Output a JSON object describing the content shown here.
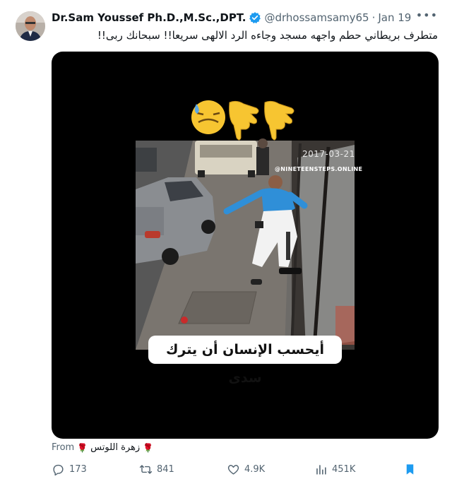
{
  "author": {
    "display_name": "Dr.Sam Youssef Ph.D.,M.Sc.,DPT.",
    "handle": "@drhossamsamy65",
    "separator": "·",
    "date": "Jan 19",
    "verified_icon": "verified-badge-icon",
    "verified_color": "#1d9bf0"
  },
  "tweet": {
    "text": "متطرف بريطاني حطم واجهه مسجد وجاءه الرد الالهى سريعا!! سبحانك ربى!!"
  },
  "media": {
    "emoji_row": "😓👇👇",
    "timestamp_overlay": "2017-03-21",
    "watermark": "@NINETEENSTEPS.ONLINE",
    "caption": "أيحسب الإنسان أن يترك سدى"
  },
  "source": {
    "label": "From",
    "name": "زهرة اللوتس",
    "rose_icon": "rose-icon"
  },
  "actions": {
    "replies": "173",
    "reposts": "841",
    "likes": "4.9K",
    "views": "451K",
    "bookmark_color": "#1d9bf0"
  },
  "colors": {
    "text": "#0f1419",
    "secondary": "#536471",
    "accent": "#1d9bf0",
    "media_bg": "#000000"
  }
}
